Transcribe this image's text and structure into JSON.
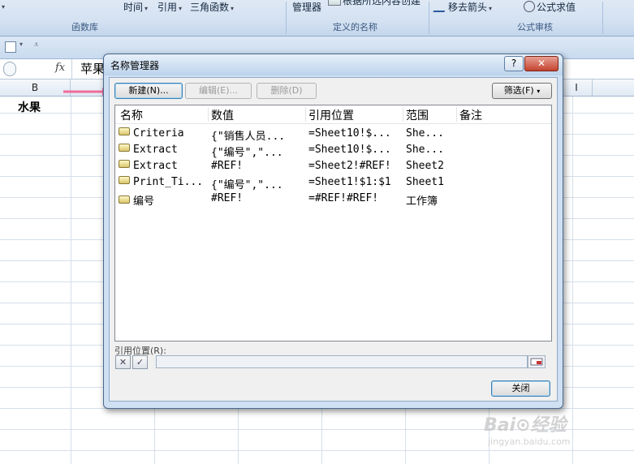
{
  "ribbon": {
    "lib_partial_arrow": "▾",
    "time_label": "时间",
    "reference_label": "引用",
    "trig_label": "三角函数",
    "group_function_library": "函数库",
    "name_manager_label": "管理器",
    "create_from_selection_label": "根据所选内容创建",
    "group_defined_names": "定义的名称",
    "remove_arrows_label": "移去箭头",
    "evaluate_formula_label": "公式求值",
    "group_formula_auditing": "公式审核"
  },
  "formula_bar": {
    "fx_label": "fx",
    "value": "苹果"
  },
  "columns": {
    "b": "B",
    "i": "I"
  },
  "sheet": {
    "b2_value": "水果"
  },
  "dialog": {
    "title": "名称管理器",
    "help_label": "?",
    "close_x": "✕",
    "new_button": "新建(N)...",
    "edit_button": "编辑(E)...",
    "delete_button": "删除(D)",
    "filter_button": "筛选(F)",
    "columns": [
      "名称",
      "数值",
      "引用位置",
      "范围",
      "备注"
    ],
    "rows": [
      {
        "name": "Criteria",
        "value": "{\"销售人员...",
        "refers_to": "=Sheet10!$...",
        "scope": "She...",
        "comment": ""
      },
      {
        "name": "Extract",
        "value": "{\"编号\",\"...",
        "refers_to": "=Sheet10!$...",
        "scope": "She...",
        "comment": ""
      },
      {
        "name": "Extract",
        "value": "#REF!",
        "refers_to": "=Sheet2!#REF!",
        "scope": "Sheet2",
        "comment": ""
      },
      {
        "name": "Print_Ti...",
        "value": "{\"编号\",\"...",
        "refers_to": "=Sheet1!$1:$1",
        "scope": "Sheet1",
        "comment": ""
      },
      {
        "name": "编号",
        "value": "#REF!",
        "refers_to": "=#REF!#REF!",
        "scope": "工作簿",
        "comment": ""
      }
    ],
    "refers_to_label": "引用位置(R):",
    "cancel_icon": "✕",
    "confirm_icon": "✓",
    "close_button": "关闭"
  },
  "watermark": {
    "brand": "Bai⊙经验",
    "url": "jingyan.baidu.com"
  },
  "colors": {
    "ribbon": "#d3e1f1",
    "dialog_frame": "#cfe0f3",
    "arrow": "#f06d99"
  }
}
